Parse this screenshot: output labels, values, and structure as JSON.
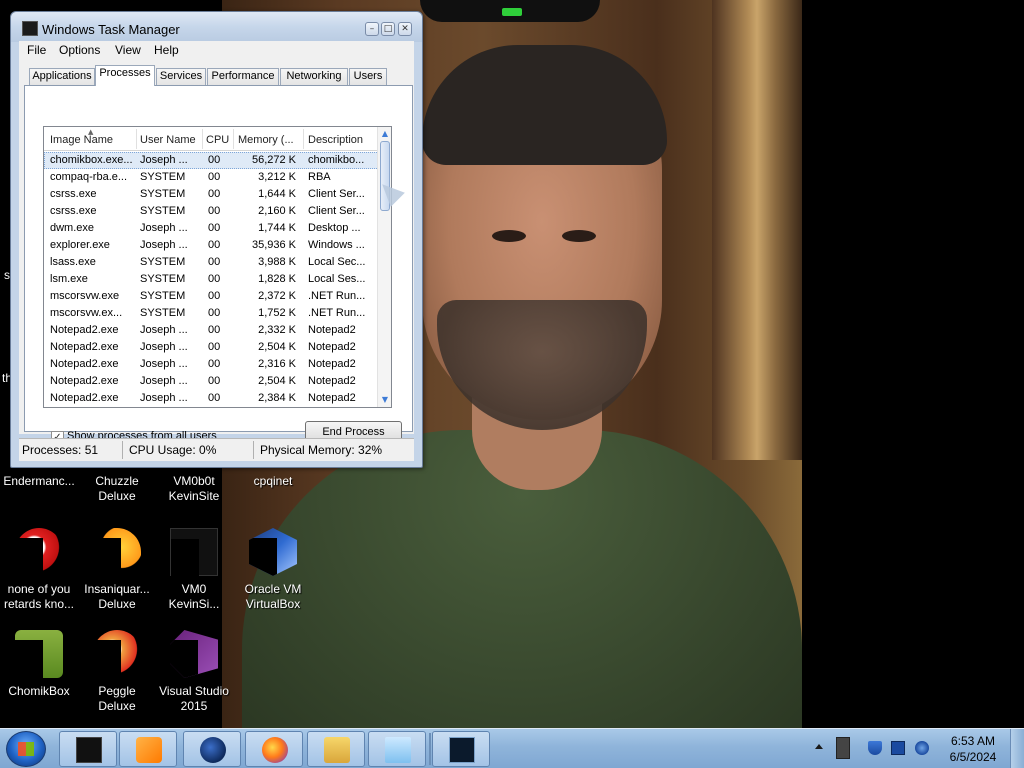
{
  "window": {
    "title": "Windows Task Manager",
    "menu": [
      "File",
      "Options",
      "View",
      "Help"
    ],
    "tabs": [
      "Applications",
      "Processes",
      "Services",
      "Performance",
      "Networking",
      "Users"
    ],
    "active_tab": "Processes",
    "columns": [
      "Image Name",
      "User Name",
      "CPU",
      "Memory (...",
      "Description"
    ],
    "processes": [
      {
        "name": "chomikbox.exe...",
        "user": "Joseph ...",
        "cpu": "00",
        "mem": "56,272 K",
        "desc": "chomikbo...",
        "selected": true
      },
      {
        "name": "compaq-rba.e...",
        "user": "SYSTEM",
        "cpu": "00",
        "mem": "3,212 K",
        "desc": "RBA"
      },
      {
        "name": "csrss.exe",
        "user": "SYSTEM",
        "cpu": "00",
        "mem": "1,644 K",
        "desc": "Client Ser..."
      },
      {
        "name": "csrss.exe",
        "user": "SYSTEM",
        "cpu": "00",
        "mem": "2,160 K",
        "desc": "Client Ser..."
      },
      {
        "name": "dwm.exe",
        "user": "Joseph ...",
        "cpu": "00",
        "mem": "1,744 K",
        "desc": "Desktop ..."
      },
      {
        "name": "explorer.exe",
        "user": "Joseph ...",
        "cpu": "00",
        "mem": "35,936 K",
        "desc": "Windows ..."
      },
      {
        "name": "lsass.exe",
        "user": "SYSTEM",
        "cpu": "00",
        "mem": "3,988 K",
        "desc": "Local Sec..."
      },
      {
        "name": "lsm.exe",
        "user": "SYSTEM",
        "cpu": "00",
        "mem": "1,828 K",
        "desc": "Local Ses..."
      },
      {
        "name": "mscorsvw.exe",
        "user": "SYSTEM",
        "cpu": "00",
        "mem": "2,372 K",
        "desc": ".NET Run..."
      },
      {
        "name": "mscorsvw.ex...",
        "user": "SYSTEM",
        "cpu": "00",
        "mem": "1,752 K",
        "desc": ".NET Run..."
      },
      {
        "name": "Notepad2.exe",
        "user": "Joseph ...",
        "cpu": "00",
        "mem": "2,332 K",
        "desc": "Notepad2"
      },
      {
        "name": "Notepad2.exe",
        "user": "Joseph ...",
        "cpu": "00",
        "mem": "2,504 K",
        "desc": "Notepad2"
      },
      {
        "name": "Notepad2.exe",
        "user": "Joseph ...",
        "cpu": "00",
        "mem": "2,316 K",
        "desc": "Notepad2"
      },
      {
        "name": "Notepad2.exe",
        "user": "Joseph ...",
        "cpu": "00",
        "mem": "2,504 K",
        "desc": "Notepad2"
      },
      {
        "name": "Notepad2.exe",
        "user": "Joseph ...",
        "cpu": "00",
        "mem": "2,384 K",
        "desc": "Notepad2"
      }
    ],
    "show_all_label": "Show processes from all users",
    "show_all_checked": true,
    "end_process_label": "End Process",
    "status": {
      "processes": "Processes: 51",
      "cpu": "CPU Usage: 0%",
      "memory": "Physical Memory: 32%"
    }
  },
  "desktop_icons": {
    "endermanc": "Endermanc...",
    "chuzzle": "Chuzzle\nDeluxe",
    "vm0b0t": "VM0b0t\nKevinSite",
    "cpqinet": "cpqinet",
    "none_of_you": "none of you\nretards kno...",
    "insaniquarium": "Insaniquar...\nDeluxe",
    "vm0": "VM0\nKevinSi...",
    "oracle_vbox": "Oracle VM\nVirtualBox",
    "chomikbox": "ChomikBox",
    "peggle": "Peggle Deluxe",
    "visual_studio": "Visual Studio\n2015"
  },
  "side_fragments": {
    "s": "s",
    "th": "th"
  },
  "taskbar": {
    "items": [
      "task-manager-monitor",
      "media-player",
      "globe-browser",
      "firefox",
      "file-explorer",
      "notepad",
      "task-manager"
    ],
    "clock_time": "6:53 AM",
    "clock_date": "6/5/2024"
  },
  "colors": {
    "titlebar": "#c6d6ea",
    "taskbar": "#8fb4da",
    "selection": "#dfeaf7",
    "tray_clock_text": "#000000"
  }
}
